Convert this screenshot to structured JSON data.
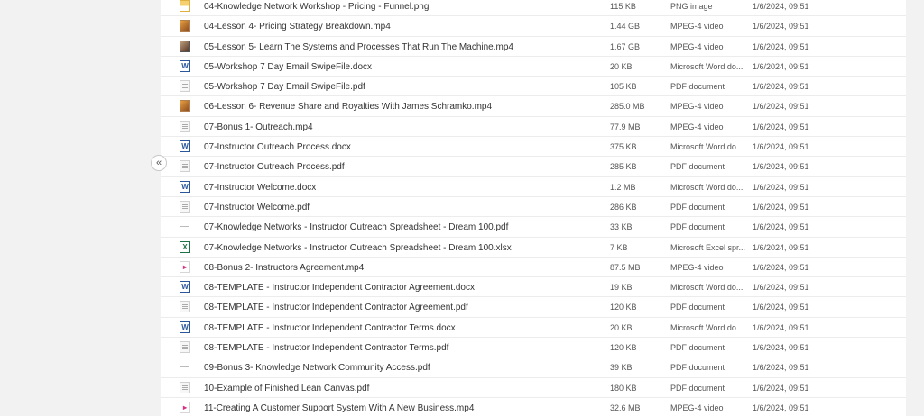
{
  "collapse_label": "«",
  "files": [
    {
      "name": "04-Knowledge Network Workshop - Pricing - Funnel.png",
      "size": "115 KB",
      "type": "PNG image",
      "date": "1/6/2024, 09:51",
      "icon": "png-icon",
      "icon_class": "ic-png",
      "glyph": ""
    },
    {
      "name": "04-Lesson 4- Pricing Strategy Breakdown.mp4",
      "size": "1.44 GB",
      "type": "MPEG-4 video",
      "date": "1/6/2024, 09:51",
      "icon": "video-thumbnail-icon",
      "icon_class": "ic-thumb",
      "glyph": ""
    },
    {
      "name": "05-Lesson 5- Learn The Systems and Processes That Run The Machine.mp4",
      "size": "1.67 GB",
      "type": "MPEG-4 video",
      "date": "1/6/2024, 09:51",
      "icon": "video-thumbnail-icon",
      "icon_class": "ic-thumb2",
      "glyph": ""
    },
    {
      "name": "05-Workshop 7 Day Email SwipeFile.docx",
      "size": "20 KB",
      "type": "Microsoft Word do...",
      "date": "1/6/2024, 09:51",
      "icon": "word-doc-icon",
      "icon_class": "ic-word",
      "glyph": "W"
    },
    {
      "name": "05-Workshop 7 Day Email SwipeFile.pdf",
      "size": "105 KB",
      "type": "PDF document",
      "date": "1/6/2024, 09:51",
      "icon": "pdf-icon",
      "icon_class": "ic-pdf",
      "glyph": ""
    },
    {
      "name": "06-Lesson 6- Revenue Share and Royalties With James Schramko.mp4",
      "size": "285.0 MB",
      "type": "MPEG-4 video",
      "date": "1/6/2024, 09:51",
      "icon": "video-thumbnail-icon",
      "icon_class": "ic-thumb",
      "glyph": ""
    },
    {
      "name": "07-Bonus 1- Outreach.mp4",
      "size": "77.9 MB",
      "type": "MPEG-4 video",
      "date": "1/6/2024, 09:51",
      "icon": "video-icon",
      "icon_class": "ic-pdf",
      "glyph": ""
    },
    {
      "name": "07-Instructor Outreach Process.docx",
      "size": "375 KB",
      "type": "Microsoft Word do...",
      "date": "1/6/2024, 09:51",
      "icon": "word-doc-icon",
      "icon_class": "ic-word",
      "glyph": "W"
    },
    {
      "name": "07-Instructor Outreach Process.pdf",
      "size": "285 KB",
      "type": "PDF document",
      "date": "1/6/2024, 09:51",
      "icon": "pdf-icon",
      "icon_class": "ic-pdf",
      "glyph": ""
    },
    {
      "name": "07-Instructor Welcome.docx",
      "size": "1.2 MB",
      "type": "Microsoft Word do...",
      "date": "1/6/2024, 09:51",
      "icon": "word-doc-icon",
      "icon_class": "ic-word",
      "glyph": "W"
    },
    {
      "name": "07-Instructor Welcome.pdf",
      "size": "286 KB",
      "type": "PDF document",
      "date": "1/6/2024, 09:51",
      "icon": "pdf-icon",
      "icon_class": "ic-pdf",
      "glyph": ""
    },
    {
      "name": "07-Knowledge Networks - Instructor Outreach Spreadsheet - Dream 100.pdf",
      "size": "33 KB",
      "type": "PDF document",
      "date": "1/6/2024, 09:51",
      "icon": "pdf-icon",
      "icon_class": "ic-blank",
      "glyph": ""
    },
    {
      "name": "07-Knowledge Networks - Instructor Outreach Spreadsheet - Dream 100.xlsx",
      "size": "7 KB",
      "type": "Microsoft Excel spr...",
      "date": "1/6/2024, 09:51",
      "icon": "excel-icon",
      "icon_class": "ic-excel",
      "glyph": "X"
    },
    {
      "name": "08-Bonus 2- Instructors Agreement.mp4",
      "size": "87.5 MB",
      "type": "MPEG-4 video",
      "date": "1/6/2024, 09:51",
      "icon": "video-icon",
      "icon_class": "ic-video",
      "glyph": "▸"
    },
    {
      "name": "08-TEMPLATE - Instructor Independent Contractor Agreement.docx",
      "size": "19 KB",
      "type": "Microsoft Word do...",
      "date": "1/6/2024, 09:51",
      "icon": "word-doc-icon",
      "icon_class": "ic-word",
      "glyph": "W"
    },
    {
      "name": "08-TEMPLATE - Instructor Independent Contractor Agreement.pdf",
      "size": "120 KB",
      "type": "PDF document",
      "date": "1/6/2024, 09:51",
      "icon": "pdf-icon",
      "icon_class": "ic-pdf",
      "glyph": ""
    },
    {
      "name": "08-TEMPLATE - Instructor Independent Contractor Terms.docx",
      "size": "20 KB",
      "type": "Microsoft Word do...",
      "date": "1/6/2024, 09:51",
      "icon": "word-doc-icon",
      "icon_class": "ic-word",
      "glyph": "W"
    },
    {
      "name": "08-TEMPLATE - Instructor Independent Contractor Terms.pdf",
      "size": "120 KB",
      "type": "PDF document",
      "date": "1/6/2024, 09:51",
      "icon": "pdf-icon",
      "icon_class": "ic-pdf",
      "glyph": ""
    },
    {
      "name": "09-Bonus 3- Knowledge Network Community Access.pdf",
      "size": "39 KB",
      "type": "PDF document",
      "date": "1/6/2024, 09:51",
      "icon": "pdf-icon",
      "icon_class": "ic-blank",
      "glyph": ""
    },
    {
      "name": "10-Example of Finished Lean Canvas.pdf",
      "size": "180 KB",
      "type": "PDF document",
      "date": "1/6/2024, 09:51",
      "icon": "pdf-icon",
      "icon_class": "ic-pdf",
      "glyph": ""
    },
    {
      "name": "11-Creating A Customer Support System With A New Business.mp4",
      "size": "32.6 MB",
      "type": "MPEG-4 video",
      "date": "1/6/2024, 09:51",
      "icon": "video-icon",
      "icon_class": "ic-video",
      "glyph": "▸"
    }
  ]
}
